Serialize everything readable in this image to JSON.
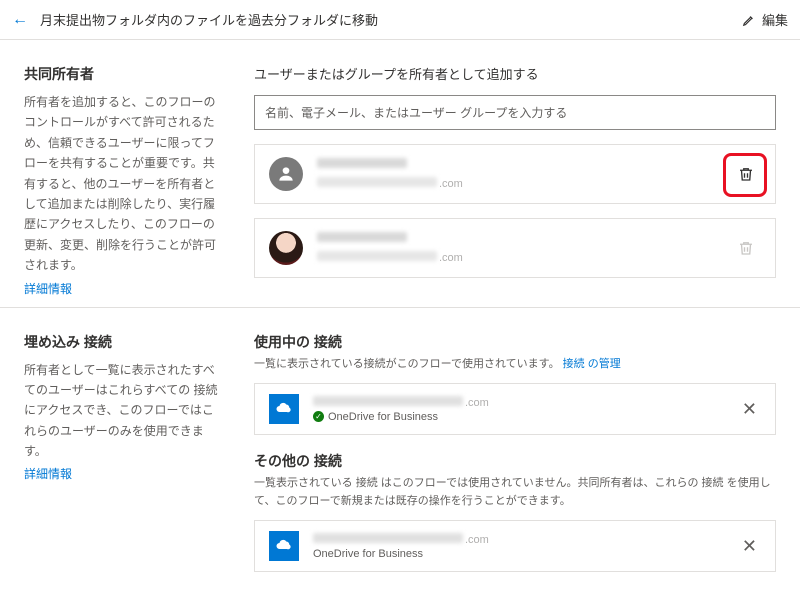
{
  "topbar": {
    "title": "月末提出物フォルダ内のファイルを過去分フォルダに移動",
    "edit_label": "編集"
  },
  "owners_section": {
    "left_heading": "共同所有者",
    "left_body": "所有者を追加すると、このフローのコントロールがすべて許可されるため、信頼できるユーザーに限ってフローを共有することが重要です。共有すると、他のユーザーを所有者として追加または削除したり、実行履歴にアクセスしたり、このフローの更新、変更、削除を行うことが許可されます。",
    "details_link": "詳細情報",
    "right_heading": "ユーザーまたはグループを所有者として追加する",
    "search_placeholder": "名前、電子メール、またはユーザー グループを入力する",
    "owners": [
      {
        "email_suffix": ".com"
      },
      {
        "email_suffix": ".com"
      }
    ]
  },
  "embed_section": {
    "left_heading": "埋め込み 接続",
    "left_body": "所有者として一覧に表示されたすべてのユーザーはこれらすべての 接続 にアクセスでき、このフローではこれらのユーザーのみを使用できます。",
    "details_link": "詳細情報"
  },
  "connections": {
    "in_use_heading": "使用中の 接続",
    "in_use_sub_prefix": "一覧に表示されている接続がこのフローで使用されています。",
    "in_use_link": "接続 の管理",
    "in_use_item": {
      "email_suffix": ".com",
      "service": "OneDrive for Business"
    },
    "other_heading": "その他の 接続",
    "other_sub": "一覧表示されている 接続 はこのフローでは使用されていません。共同所有者は、これらの 接続 を使用して、このフローで新規または既存の操作を行うことができます。",
    "other_item": {
      "email_suffix": ".com",
      "service": "OneDrive for Business"
    }
  }
}
